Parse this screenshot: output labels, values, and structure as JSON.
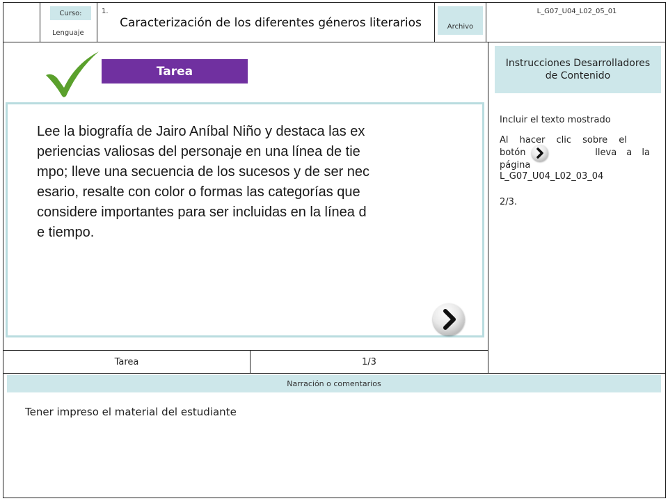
{
  "header": {
    "course_label": "Curso:",
    "course_value": "Lenguaje",
    "number": "1.",
    "title": "Caracterización de los diferentes géneros literarios",
    "file_label": "Archivo",
    "code": "L_G07_U04_L02_05_01"
  },
  "screen": {
    "tab_label": "Tarea",
    "body_text": "Lee la biografía de Jairo Aníbal Niño y destaca las ex periencias valiosas del personaje en una línea de tie mpo; lleve una secuencia de los sucesos y de ser nec esario, resalte con color o formas las categorías que considere importantes para ser incluidas en la línea d e tiempo.",
    "body_lines": [
      "Lee la biografía de Jairo Aníbal Niño y destaca las ex",
      "periencias valiosas del personaje en una línea de tie",
      "mpo; lleve una secuencia de los sucesos y de ser nec",
      "esario, resalte con color o formas las categorías que",
      "considere importantes para ser incluidas en la línea d",
      "e tiempo."
    ]
  },
  "instructions": {
    "header": "Instrucciones Desarrolladores de Contenido",
    "line1": "Incluir el texto mostrado",
    "p2_a": "Al hacer clic sobre el",
    "p2_b": "botón",
    "p2_c": "lleva a la",
    "p2_d": "página",
    "p2_e": "L_G07_U04_L02_03_04",
    "line3": "2/3."
  },
  "footer_row": {
    "left": "Tarea",
    "right": "1/3"
  },
  "narration": {
    "header": "Narración o comentarios",
    "text": "Tener impreso el material del estudiante"
  },
  "colors": {
    "tab_purple": "#7030a0",
    "teal": "#cde7ea",
    "check_green": "#5aa02c",
    "frame_teal": "#b9dcdf"
  }
}
